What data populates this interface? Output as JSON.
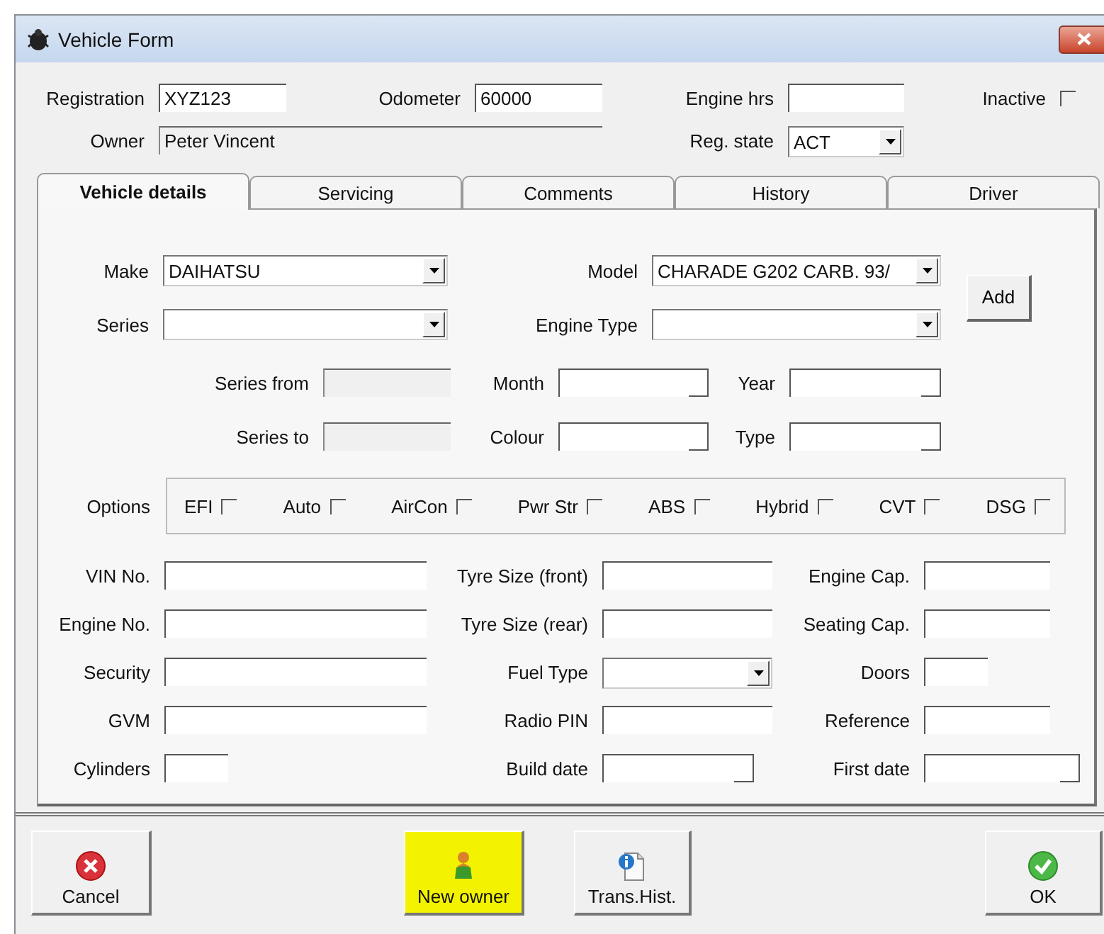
{
  "window": {
    "title": "Vehicle Form"
  },
  "header": [
    {
      "kind": "text",
      "label": "Registration",
      "value": "XYZ123"
    },
    {
      "kind": "text",
      "label": "Odometer",
      "value": "60000"
    },
    {
      "kind": "text",
      "label": "Engine hrs"
    },
    {
      "kind": "checkbox",
      "label": "Inactive",
      "checked": false
    },
    {
      "kind": "readonly",
      "label": "Owner",
      "value": "Peter Vincent"
    },
    {
      "kind": "combo",
      "label": "Reg. state",
      "value": "ACT"
    }
  ],
  "tabs": [
    {
      "label": "Vehicle details",
      "selected": true
    },
    {
      "label": "Servicing",
      "selected": false
    },
    {
      "label": "Comments",
      "selected": false
    },
    {
      "label": "History",
      "selected": false
    },
    {
      "label": "Driver",
      "selected": false
    }
  ],
  "model_rows": [
    [
      {
        "kind": "combo",
        "label": "Make",
        "value": "DAIHATSU"
      },
      {
        "kind": "combo",
        "label": "Model",
        "value": "CHARADE G202 CARB. 93/"
      }
    ],
    [
      {
        "kind": "combo",
        "label": "Series"
      },
      {
        "kind": "combo",
        "label": "Engine Type"
      }
    ]
  ],
  "add_button": "Add",
  "period_rows": [
    [
      {
        "kind": "readonly",
        "label": "Series from"
      },
      {
        "kind": "date",
        "label": "Month"
      },
      {
        "kind": "date",
        "label": "Year"
      }
    ],
    [
      {
        "kind": "readonly",
        "label": "Series to"
      },
      {
        "kind": "date",
        "label": "Colour"
      },
      {
        "kind": "date",
        "label": "Type"
      }
    ]
  ],
  "options": {
    "label": "Options",
    "items": [
      {
        "label": "EFI",
        "checked": false
      },
      {
        "label": "Auto",
        "checked": false
      },
      {
        "label": "AirCon",
        "checked": false
      },
      {
        "label": "Pwr Str",
        "checked": false
      },
      {
        "label": "ABS",
        "checked": false
      },
      {
        "label": "Hybrid",
        "checked": false
      },
      {
        "label": "CVT",
        "checked": false
      },
      {
        "label": "DSG",
        "checked": false
      }
    ]
  },
  "detail_rows": [
    [
      {
        "kind": "text",
        "label": "VIN No."
      },
      {
        "kind": "text",
        "label": "Tyre Size (front)"
      },
      {
        "kind": "text",
        "label": "Engine Cap."
      }
    ],
    [
      {
        "kind": "text",
        "label": "Engine No."
      },
      {
        "kind": "text",
        "label": "Tyre Size (rear)"
      },
      {
        "kind": "text",
        "label": "Seating Cap."
      }
    ],
    [
      {
        "kind": "text",
        "label": "Security"
      },
      {
        "kind": "combo",
        "label": "Fuel Type"
      },
      {
        "kind": "short",
        "label": "Doors"
      }
    ],
    [
      {
        "kind": "text",
        "label": "GVM"
      },
      {
        "kind": "text",
        "label": "Radio PIN"
      },
      {
        "kind": "text",
        "label": "Reference"
      }
    ],
    [
      {
        "kind": "short",
        "label": "Cylinders"
      },
      {
        "kind": "date",
        "label": "Build date"
      },
      {
        "kind": "date",
        "label": "First date"
      }
    ]
  ],
  "buttons": [
    {
      "kind": "cancel",
      "label": "Cancel",
      "highlighted": false
    },
    {
      "kind": "new-owner",
      "label": "New owner",
      "highlighted": true
    },
    {
      "kind": "history",
      "label": "Trans.Hist.",
      "highlighted": false
    },
    {
      "kind": "ok",
      "label": "OK",
      "highlighted": false
    }
  ]
}
